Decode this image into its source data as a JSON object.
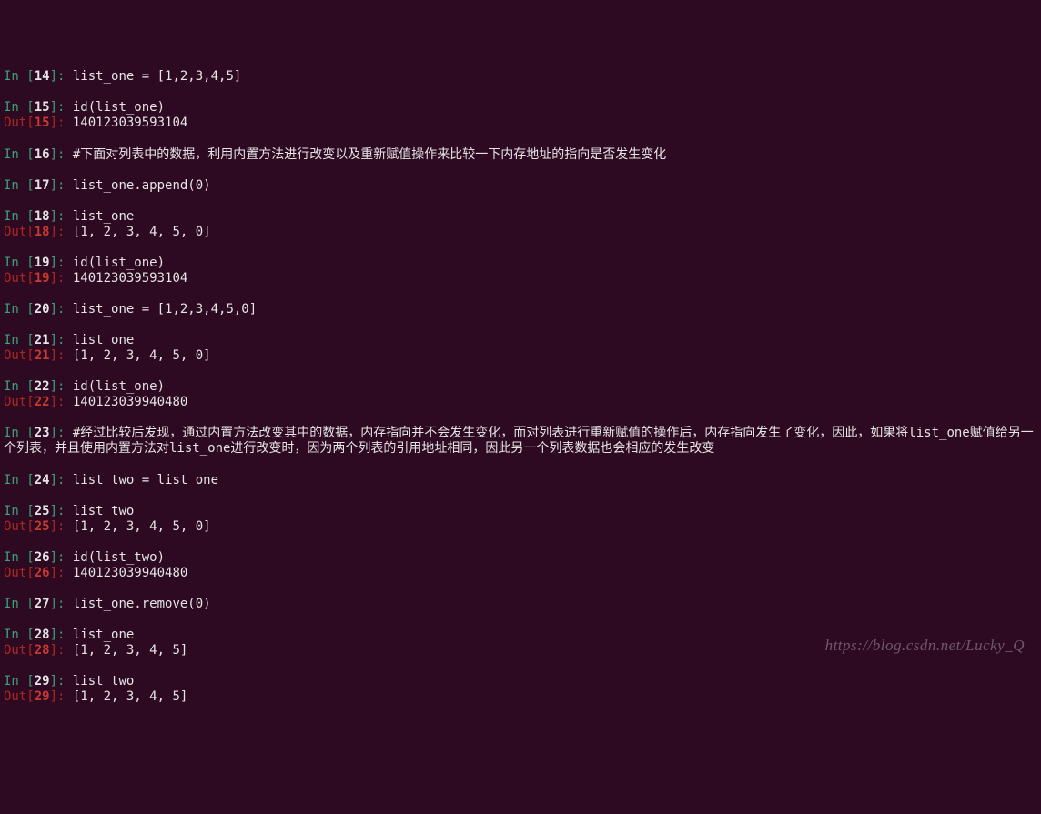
{
  "lines": [
    {
      "type": "in",
      "n": 14,
      "code": "list_one = [1,2,3,4,5]"
    },
    {
      "type": "blank"
    },
    {
      "type": "in",
      "n": 15,
      "code": "id(list_one)"
    },
    {
      "type": "out",
      "n": 15,
      "code": "140123039593104"
    },
    {
      "type": "blank"
    },
    {
      "type": "in",
      "n": 16,
      "code": "#下面对列表中的数据，利用内置方法进行改变以及重新赋值操作来比较一下内存地址的指向是否发生变化"
    },
    {
      "type": "blank"
    },
    {
      "type": "in",
      "n": 17,
      "code": "list_one.append(0)"
    },
    {
      "type": "blank"
    },
    {
      "type": "in",
      "n": 18,
      "code": "list_one"
    },
    {
      "type": "out",
      "n": 18,
      "code": "[1, 2, 3, 4, 5, 0]"
    },
    {
      "type": "blank"
    },
    {
      "type": "in",
      "n": 19,
      "code": "id(list_one)"
    },
    {
      "type": "out",
      "n": 19,
      "code": "140123039593104"
    },
    {
      "type": "blank"
    },
    {
      "type": "in",
      "n": 20,
      "code": "list_one = [1,2,3,4,5,0]"
    },
    {
      "type": "blank"
    },
    {
      "type": "in",
      "n": 21,
      "code": "list_one"
    },
    {
      "type": "out",
      "n": 21,
      "code": "[1, 2, 3, 4, 5, 0]"
    },
    {
      "type": "blank"
    },
    {
      "type": "in",
      "n": 22,
      "code": "id(list_one)"
    },
    {
      "type": "out",
      "n": 22,
      "code": "140123039940480"
    },
    {
      "type": "blank"
    },
    {
      "type": "in",
      "n": 23,
      "code": "#经过比较后发现，通过内置方法改变其中的数据，内存指向并不会发生变化，而对列表进行重新赋值的操作后，内存指向发生了变化，因此，如果将list_one赋值给另一个列表，并且使用内置方法对list_one进行改变时，因为两个列表的引用地址相同，因此另一个列表数据也会相应的发生改变"
    },
    {
      "type": "blank"
    },
    {
      "type": "in",
      "n": 24,
      "code": "list_two = list_one"
    },
    {
      "type": "blank"
    },
    {
      "type": "in",
      "n": 25,
      "code": "list_two"
    },
    {
      "type": "out",
      "n": 25,
      "code": "[1, 2, 3, 4, 5, 0]"
    },
    {
      "type": "blank"
    },
    {
      "type": "in",
      "n": 26,
      "code": "id(list_two)"
    },
    {
      "type": "out",
      "n": 26,
      "code": "140123039940480"
    },
    {
      "type": "blank"
    },
    {
      "type": "in",
      "n": 27,
      "code": "list_one.remove(0)"
    },
    {
      "type": "blank"
    },
    {
      "type": "in",
      "n": 28,
      "code": "list_one"
    },
    {
      "type": "out",
      "n": 28,
      "code": "[1, 2, 3, 4, 5]"
    },
    {
      "type": "blank"
    },
    {
      "type": "in",
      "n": 29,
      "code": "list_two"
    },
    {
      "type": "out",
      "n": 29,
      "code": "[1, 2, 3, 4, 5]"
    }
  ],
  "prompts": {
    "in_prefix": "In [",
    "in_suffix": "]: ",
    "out_prefix": "Out[",
    "out_suffix": "]: "
  },
  "watermark": "https://blog.csdn.net/Lucky_Q"
}
